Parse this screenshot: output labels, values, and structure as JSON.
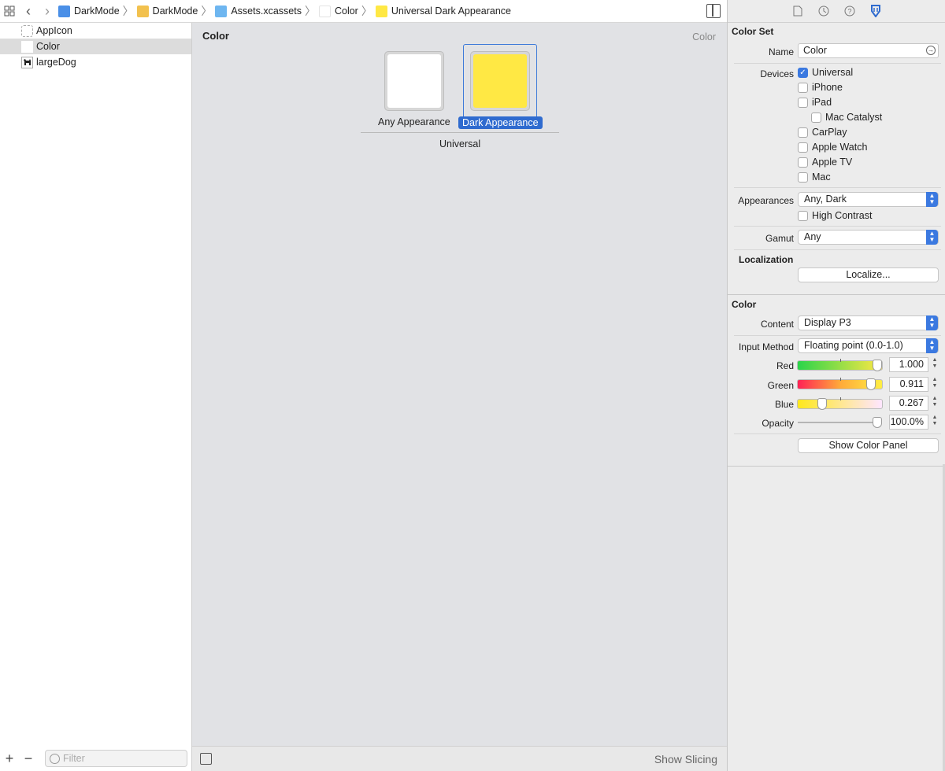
{
  "breadcrumbs": [
    {
      "label": "DarkMode",
      "icon": "project-file-icon",
      "color": "#4a8fe7"
    },
    {
      "label": "DarkMode",
      "icon": "folder-icon",
      "color": "#f2c14e"
    },
    {
      "label": "Assets.xcassets",
      "icon": "asset-catalog-folder-icon",
      "color": "#6eb6f0"
    },
    {
      "label": "Color",
      "icon": "color-set-icon",
      "color": "#ffffff"
    },
    {
      "label": "Universal Dark Appearance",
      "icon": "color-swatch-icon",
      "color": "#ffe844"
    }
  ],
  "outline": {
    "items": [
      {
        "label": "AppIcon",
        "icon": "app-icon-placeholder-icon"
      },
      {
        "label": "Color",
        "icon": "color-set-icon"
      },
      {
        "label": "largeDog",
        "icon": "dog-image-icon"
      }
    ],
    "filter_placeholder": "Filter"
  },
  "canvas": {
    "title": "Color",
    "type_label": "Color",
    "slots": [
      {
        "label": "Any Appearance",
        "color": "#ffffff"
      },
      {
        "label": "Dark Appearance",
        "color": "#ffe844"
      }
    ],
    "group_label": "Universal",
    "footer_action": "Show Slicing"
  },
  "inspector": {
    "color_set": {
      "title": "Color Set",
      "name_label": "Name",
      "name_value": "Color",
      "devices_label": "Devices",
      "devices": [
        {
          "label": "Universal",
          "checked": true
        },
        {
          "label": "iPhone",
          "checked": false
        },
        {
          "label": "iPad",
          "checked": false
        },
        {
          "label": "Mac Catalyst",
          "checked": false
        },
        {
          "label": "CarPlay",
          "checked": false
        },
        {
          "label": "Apple Watch",
          "checked": false
        },
        {
          "label": "Apple TV",
          "checked": false
        },
        {
          "label": "Mac",
          "checked": false
        }
      ],
      "appearances_label": "Appearances",
      "appearances_value": "Any, Dark",
      "high_contrast_label": "High Contrast",
      "gamut_label": "Gamut",
      "gamut_value": "Any",
      "localization_title": "Localization",
      "localize_button": "Localize..."
    },
    "color": {
      "title": "Color",
      "content_label": "Content",
      "content_value": "Display P3",
      "input_method_label": "Input Method",
      "input_method_value": "Floating point (0.0-1.0)",
      "channels": [
        {
          "label": "Red",
          "value": "1.000",
          "level": 1.0
        },
        {
          "label": "Green",
          "value": "0.911",
          "level": 0.911
        },
        {
          "label": "Blue",
          "value": "0.267",
          "level": 0.267
        },
        {
          "label": "Opacity",
          "value": "100.0%",
          "level": 1.0
        }
      ],
      "show_panel_button": "Show Color Panel"
    }
  },
  "colors": {
    "accent": "#3b79e0",
    "selection": "#2f6bcf"
  }
}
